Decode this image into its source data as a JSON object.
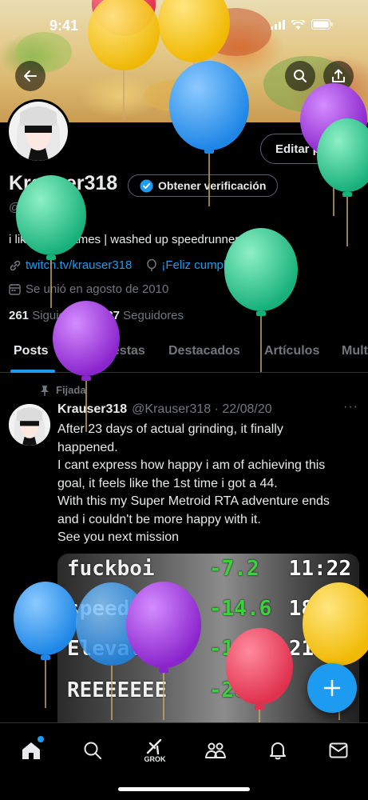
{
  "status_bar": {
    "time": "9:41"
  },
  "header": {
    "back_icon": "arrow-left-icon",
    "search_icon": "search-icon",
    "share_icon": "share-icon"
  },
  "profile": {
    "edit_button": "Editar perfil",
    "display_name": "Krauser318",
    "verify_label": "Obtener verificación",
    "handle": "@Krauser318",
    "bio": "i like videogames | washed up speedrunner",
    "website": "twitch.tv/krauser318",
    "birthday": "¡Feliz cumpleaños!",
    "joined": "Se unió en agosto de 2010",
    "following_count": "261",
    "following_label": "Siguiendo",
    "followers_count": "527",
    "followers_label": "Seguidores"
  },
  "tabs": [
    {
      "label": "Posts"
    },
    {
      "label": "Respuestas"
    },
    {
      "label": "Destacados"
    },
    {
      "label": "Artículos"
    },
    {
      "label": "Mult"
    }
  ],
  "post": {
    "pinned_label": "Fijada",
    "name": "Krauser318",
    "handle_date": "@Krauser318 · 22/08/20",
    "more": "···",
    "lines": [
      "After 23 days of actual grinding, it finally",
      "happened.",
      "I cant express how happy i am of achieving this",
      "goal, it feels like the 1st time i got a 44.",
      "With this my Super Metroid RTA adventure ends",
      "and i couldn't be more happy with it.",
      "See you next mission"
    ],
    "splits": [
      {
        "name": "fuckboi",
        "diff": "-7.2",
        "time": "11:22"
      },
      {
        "name": "speedy",
        "diff": "-14.6",
        "time": "18:57"
      },
      {
        "name": "Elevator",
        "diff": "-14",
        "time": "21:06"
      },
      {
        "name": "REEEEEEE",
        "diff": "-28",
        "time": "2"
      }
    ]
  },
  "bottom_nav": {
    "grok_label": "GROK",
    "icons": [
      "home-icon",
      "search-icon",
      "grok-icon",
      "communities-icon",
      "notifications-icon",
      "messages-icon"
    ]
  },
  "colors": {
    "accent": "#1d9bf0",
    "background": "#000000",
    "text": "#e7e9ea",
    "muted": "#71767b",
    "balloon_red": "#ef3e5a",
    "balloon_yellow": "#f5c518",
    "balloon_blue": "#2a9df4",
    "balloon_green": "#27c48a",
    "balloon_purple": "#9b2fd6"
  }
}
